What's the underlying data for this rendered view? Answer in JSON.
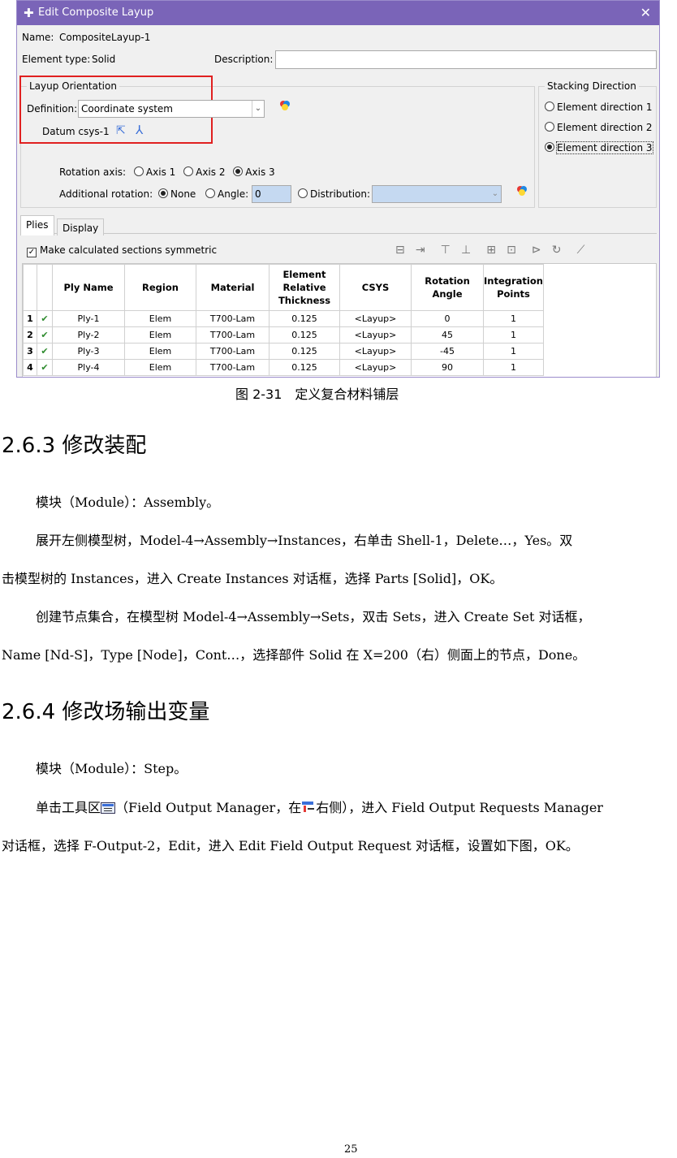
{
  "dialog": {
    "title": "Edit Composite Layup",
    "name_label": "Name:",
    "name_value": "CompositeLayup-1",
    "element_type_label": "Element type:",
    "element_type_value": "Solid",
    "description_label": "Description:",
    "description_value": "",
    "layup_orientation": {
      "title": "Layup Orientation",
      "definition_label": "Definition:",
      "definition_value": "Coordinate system",
      "datum_label": "Datum csys-1",
      "highlight_color": "#e02020"
    },
    "stacking_direction": {
      "title": "Stacking Direction",
      "options": [
        "Element direction 1",
        "Element direction 2",
        "Element direction 3"
      ],
      "selected": "Element direction 3"
    },
    "rotation_axis": {
      "label": "Rotation axis:",
      "options": [
        "Axis 1",
        "Axis 2",
        "Axis 3"
      ],
      "selected": "Axis 3"
    },
    "additional_rotation": {
      "label": "Additional rotation:",
      "none_label": "None",
      "angle_label": "Angle:",
      "angle_value": "0",
      "distribution_label": "Distribution:",
      "selected": "None"
    },
    "tabs": [
      "Plies",
      "Display"
    ],
    "active_tab": "Plies",
    "symmetric_label": "Make calculated sections symmetric",
    "table": {
      "headers": [
        "Ply Name",
        "Region",
        "Material",
        "Element Relative Thickness",
        "CSYS",
        "Rotation Angle",
        "Integration Points"
      ],
      "rows": [
        {
          "idx": "1",
          "ply": "Ply-1",
          "region": "Elem",
          "material": "T700-Lam",
          "thickness": "0.125",
          "csys": "<Layup>",
          "angle": "0",
          "points": "1"
        },
        {
          "idx": "2",
          "ply": "Ply-2",
          "region": "Elem",
          "material": "T700-Lam",
          "thickness": "0.125",
          "csys": "<Layup>",
          "angle": "45",
          "points": "1"
        },
        {
          "idx": "3",
          "ply": "Ply-3",
          "region": "Elem",
          "material": "T700-Lam",
          "thickness": "0.125",
          "csys": "<Layup>",
          "angle": "-45",
          "points": "1"
        },
        {
          "idx": "4",
          "ply": "Ply-4",
          "region": "Elem",
          "material": "T700-Lam",
          "thickness": "0.125",
          "csys": "<Layup>",
          "angle": "90",
          "points": "1"
        }
      ]
    },
    "colors": {
      "titlebar": "#7a64b8",
      "angle_field": "#c5d9f1"
    }
  },
  "doc": {
    "caption": "图 2-31　定义复合材料铺层",
    "s263_title": "2.6.3 修改装配",
    "s263_p1": "模块（Module）：Assembly。",
    "s263_p2a": "展开左侧模型树，Model-4→Assembly→Instances，右单击 Shell-1，Delete…，Yes。双",
    "s263_p2b": "击模型树的 Instances，进入 Create Instances 对话框，选择 Parts [Solid]，OK。",
    "s263_p3a": "创建节点集合，在模型树 Model-4→Assembly→Sets，双击 Sets，进入 Create Set 对话框，",
    "s263_p3b": "Name [Nd-S]，Type [Node]，Cont…，选择部件 Solid 在 X=200（右）侧面上的节点，Done。",
    "s264_title": "2.6.4 修改场输出变量",
    "s264_p1": "模块（Module）：Step。",
    "s264_p2a_1": "单击工具区",
    "s264_p2a_2": "（Field Output Manager，在",
    "s264_p2a_3": "右侧），进入 Field Output Requests Manager",
    "s264_p2b": "对话框，选择 F-Output-2，Edit，进入 Edit Field Output Request 对话框，设置如下图，OK。",
    "page_number": "25"
  }
}
